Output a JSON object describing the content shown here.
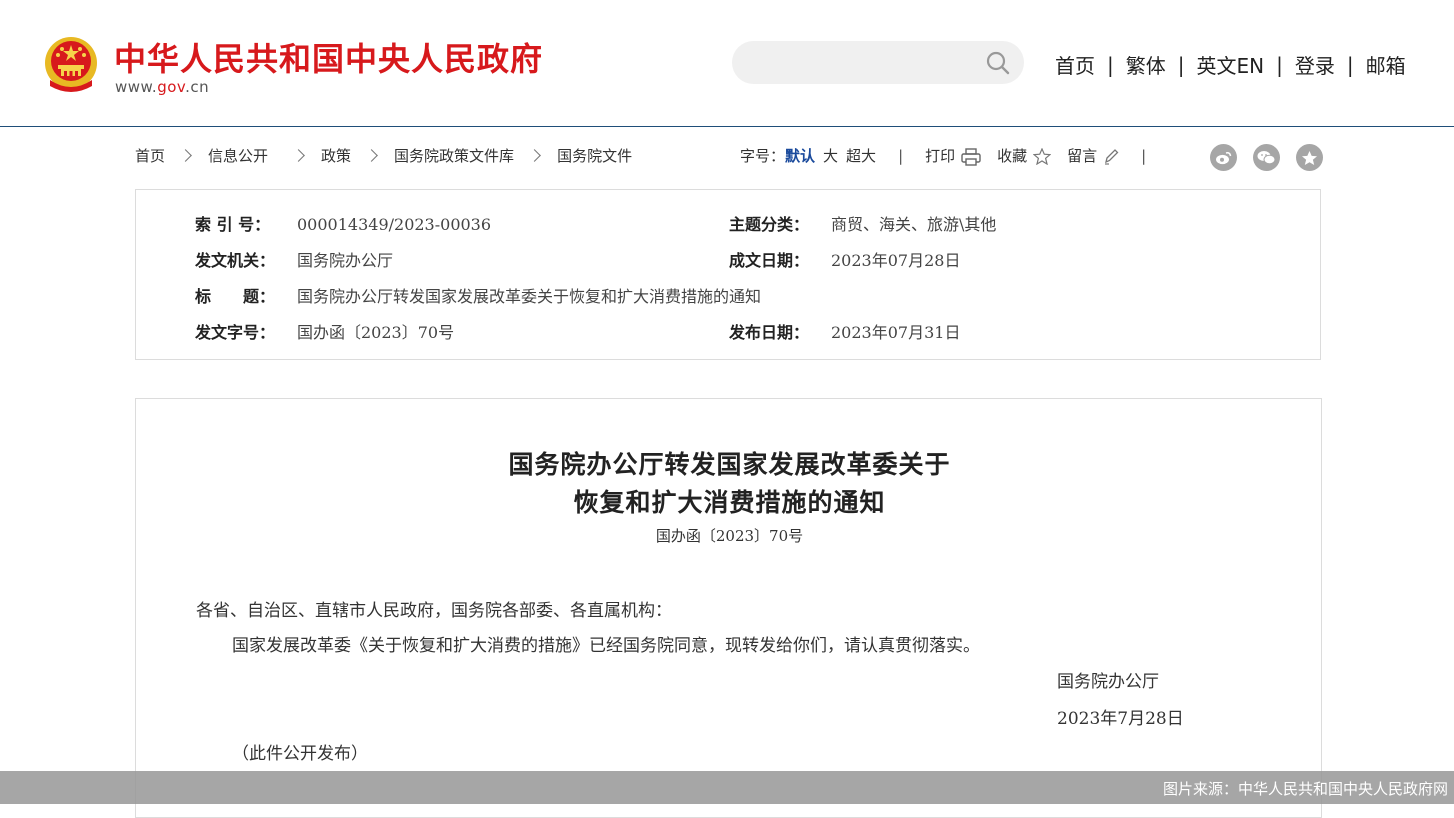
{
  "header": {
    "site_title": "中华人民共和国中央人民政府",
    "site_url_prefix": "www.",
    "site_url_brand": "gov",
    "site_url_suffix": ".cn",
    "search_placeholder": "",
    "nav": [
      "首页",
      "繁体",
      "英文EN",
      "登录",
      "邮箱"
    ],
    "nav_separator": "|"
  },
  "breadcrumb": [
    "首页",
    "信息公开",
    "政策",
    "国务院政策文件库",
    "国务院文件"
  ],
  "tools": {
    "font_size_label": "字号：",
    "font_default": "默认",
    "font_large": "大",
    "font_xlarge": "超大",
    "separator": "|",
    "print": "打印",
    "favorite": "收藏",
    "comment": "留言"
  },
  "info": {
    "index_label": "索 引 号：",
    "index_value": "000014349/2023-00036",
    "topic_label": "主题分类：",
    "topic_value": "商贸、海关、旅游\\其他",
    "issuer_label": "发文机关：",
    "issuer_value": "国务院办公厅",
    "date_written_label": "成文日期：",
    "date_written_value": "2023年07月28日",
    "title_label": "标　　题：",
    "title_value": "国务院办公厅转发国家发展改革委关于恢复和扩大消费措施的通知",
    "doc_no_label": "发文字号：",
    "doc_no_value": "国办函〔2023〕70号",
    "publish_date_label": "发布日期：",
    "publish_date_value": "2023年07月31日"
  },
  "document": {
    "title_line1": "国务院办公厅转发国家发展改革委关于",
    "title_line2": "恢复和扩大消费措施的通知",
    "doc_number": "国办函〔2023〕70号",
    "salutation": "各省、自治区、直辖市人民政府，国务院各部委、各直属机构：",
    "body": "国家发展改革委《关于恢复和扩大消费的措施》已经国务院同意，现转发给你们，请认真贯彻落实。",
    "signature": "国务院办公厅",
    "date": "2023年7月28日",
    "note": "（此件公开发布）"
  },
  "caption": "图片来源：中华人民共和国中央人民政府网",
  "colors": {
    "brand_red": "#d7191c",
    "active_blue": "#1a4a9c",
    "header_rule": "#1f4e79",
    "icon_gray": "#a6a6a6"
  },
  "icons": [
    "national-emblem",
    "search-icon",
    "print-icon",
    "star-icon",
    "pencil-icon",
    "weibo-icon",
    "wechat-icon",
    "favorite-star-icon"
  ]
}
